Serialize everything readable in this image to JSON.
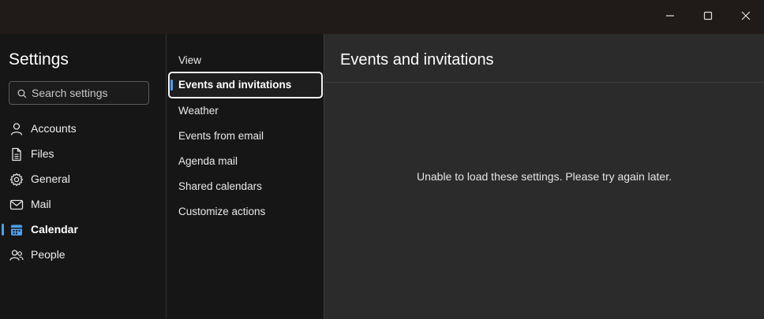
{
  "window": {
    "controls": {
      "minimize_icon": "minimize-icon",
      "maximize_icon": "maximize-icon",
      "close_icon": "close-icon"
    }
  },
  "nav": {
    "title": "Settings",
    "search": {
      "placeholder": "Search settings",
      "value": ""
    },
    "items": [
      {
        "label": "Accounts",
        "icon": "person-icon",
        "active": false
      },
      {
        "label": "Files",
        "icon": "document-icon",
        "active": false
      },
      {
        "label": "General",
        "icon": "gear-icon",
        "active": false
      },
      {
        "label": "Mail",
        "icon": "envelope-icon",
        "active": false
      },
      {
        "label": "Calendar",
        "icon": "calendar-icon",
        "active": true
      },
      {
        "label": "People",
        "icon": "people-icon",
        "active": false
      }
    ]
  },
  "subnav": {
    "items": [
      {
        "label": "View",
        "active": false
      },
      {
        "label": "Events and invitations",
        "active": true
      },
      {
        "label": "Weather",
        "active": false
      },
      {
        "label": "Events from email",
        "active": false
      },
      {
        "label": "Agenda mail",
        "active": false
      },
      {
        "label": "Shared calendars",
        "active": false
      },
      {
        "label": "Customize actions",
        "active": false
      }
    ]
  },
  "content": {
    "title": "Events and invitations",
    "message": "Unable to load these settings. Please try again later."
  },
  "colors": {
    "accent": "#4aa0f0",
    "titlebar": "#201a18",
    "nav_bg": "#161616",
    "content_bg": "#2b2b2b"
  }
}
